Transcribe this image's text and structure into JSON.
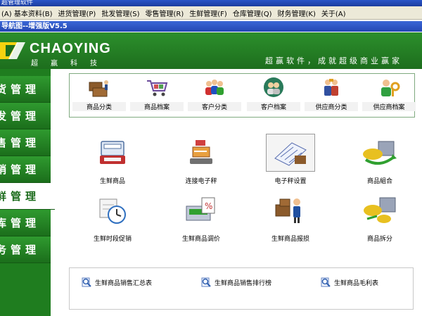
{
  "window": {
    "title": "超管理软件",
    "subtitle": "导航图--增强版V5.5"
  },
  "menu": [
    "(A) 基本资料(B)",
    "进货管理(P)",
    "批发管理(S)",
    "零售管理(R)",
    "生鲜管理(F)",
    "仓库管理(Q)",
    "财务管理(K)",
    "关于(A)"
  ],
  "banner": {
    "brand": "CHAOYING",
    "brand_cn": "超赢科技",
    "slogan": "超赢软件，成就超级商业赢家"
  },
  "sidebar": [
    {
      "label": "货管理"
    },
    {
      "label": "发管理"
    },
    {
      "label": "售管理"
    },
    {
      "label": "销管理"
    },
    {
      "label": "鲜管理",
      "active": true
    },
    {
      "label": "库管理"
    },
    {
      "label": "务管理"
    }
  ],
  "categories": [
    {
      "label": "商品分类",
      "icon": "boxes-icon"
    },
    {
      "label": "商品档案",
      "icon": "cart-icon"
    },
    {
      "label": "客户分类",
      "icon": "people-group-icon"
    },
    {
      "label": "客户档案",
      "icon": "people-circle-icon"
    },
    {
      "label": "供应商分类",
      "icon": "supplier-icon"
    },
    {
      "label": "供应商档案",
      "icon": "supplier-key-icon"
    }
  ],
  "tiles": [
    {
      "label": "生鲜商品",
      "icon": "cash-register-icon"
    },
    {
      "label": "连接电子秤",
      "icon": "scale-icon"
    },
    {
      "label": "电子秤设置",
      "icon": "scale-setup-icon",
      "selected": true
    },
    {
      "label": "商品組合",
      "icon": "combine-goods-icon"
    },
    {
      "label": "生鲜时段促销",
      "icon": "clock-calendar-icon"
    },
    {
      "label": "生鲜商品调价",
      "icon": "price-adjust-icon"
    },
    {
      "label": "生鲜商品报损",
      "icon": "loss-report-icon"
    },
    {
      "label": "商品拆分",
      "icon": "split-goods-icon"
    }
  ],
  "reports": [
    {
      "label": "生鲜商品销售汇总表"
    },
    {
      "label": "生鲜商品销售排行榜"
    },
    {
      "label": "生鲜商品毛利表"
    }
  ]
}
